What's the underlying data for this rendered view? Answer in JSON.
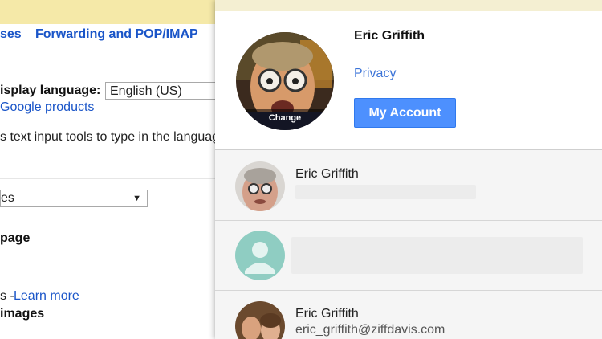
{
  "settings": {
    "tabs": {
      "partial_tab": "ses",
      "forwarding_tab": "Forwarding and POP/IMAP"
    },
    "language": {
      "label": "isplay language:",
      "value": "English (US)",
      "google_products_link": "Google products",
      "input_tools_text": "s text input tools to type in the languag"
    },
    "select_value": "es",
    "page_label": "page",
    "learn_more_prefix": "s -",
    "learn_more_link": "Learn more",
    "images_label": "images"
  },
  "account_panel": {
    "current": {
      "name": "Eric Griffith",
      "change_label": "Change",
      "privacy_link": "Privacy",
      "my_account_button": "My Account"
    },
    "accounts": [
      {
        "name": "Eric Griffith",
        "email": ""
      },
      {
        "name": "",
        "email": ""
      },
      {
        "name": "Eric Griffith",
        "email": "eric_griffith@ziffdavis.com"
      }
    ]
  },
  "colors": {
    "link_blue": "#1a55c8",
    "primary_button": "#4d90fe",
    "top_bar": "#f5e9a8",
    "default_avatar": "#8fcdc2"
  },
  "icons": {
    "select_arrow": "dropdown-arrow-icon",
    "default_avatar": "person-silhouette-icon"
  }
}
